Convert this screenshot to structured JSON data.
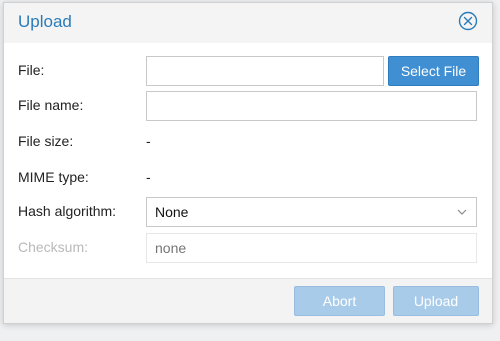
{
  "dialog": {
    "title": "Upload",
    "fields": {
      "file": {
        "label": "File:",
        "value": "",
        "button": "Select File"
      },
      "file_name": {
        "label": "File name:",
        "value": ""
      },
      "file_size": {
        "label": "File size:",
        "value": "-"
      },
      "mime_type": {
        "label": "MIME type:",
        "value": "-"
      },
      "hash_algorithm": {
        "label": "Hash algorithm:",
        "value": "None"
      },
      "checksum": {
        "label": "Checksum:",
        "placeholder": "none"
      }
    },
    "footer": {
      "abort_label": "Abort",
      "upload_label": "Upload"
    }
  },
  "colors": {
    "title": "#2a7cb8",
    "primary_button": "#3f8fd2",
    "disabled_button": "#a8cbe9"
  },
  "icons": {
    "close": "close-circle-icon",
    "dropdown": "chevron-down-icon"
  }
}
